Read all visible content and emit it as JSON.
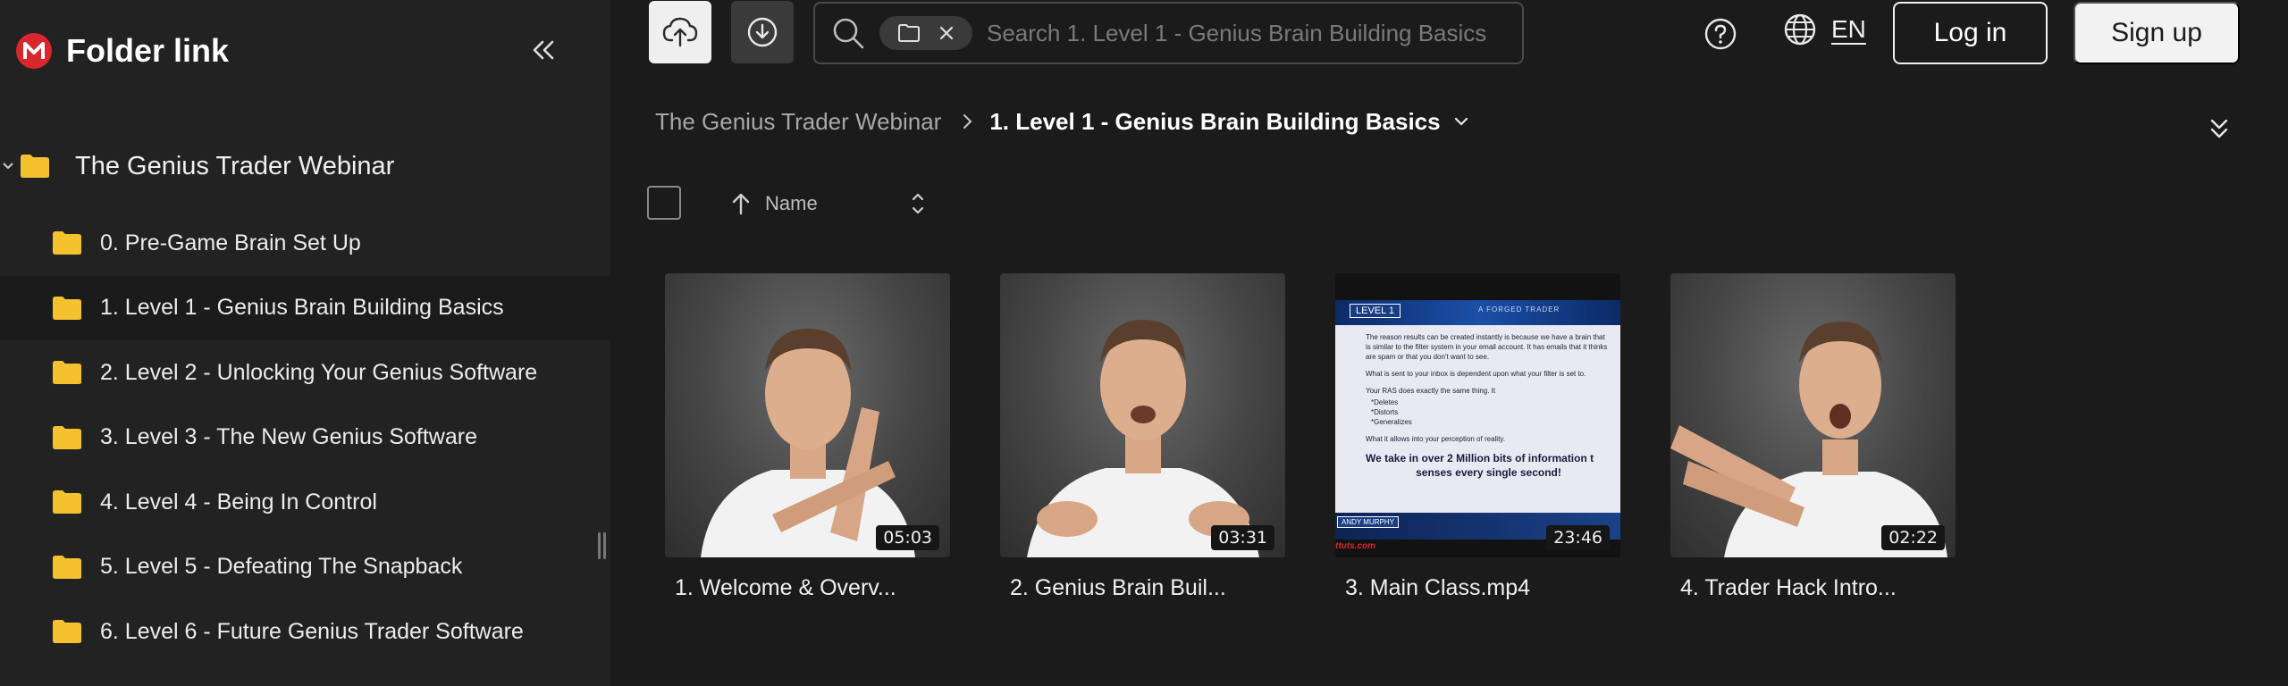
{
  "brand": {
    "name": "Folder link"
  },
  "sidebar": {
    "root": "The Genius Trader Webinar",
    "items": [
      {
        "label": "0. Pre-Game Brain Set Up"
      },
      {
        "label": "1. Level 1 - Genius Brain Building Basics"
      },
      {
        "label": "2. Level 2 - Unlocking Your Genius Software"
      },
      {
        "label": "3. Level 3 - The New Genius Software"
      },
      {
        "label": "4. Level 4 - Being In Control"
      },
      {
        "label": "5. Level 5 - Defeating The Snapback"
      },
      {
        "label": "6. Level 6 - Future Genius Trader Software"
      }
    ]
  },
  "search": {
    "placeholder": "Search 1. Level 1 - Genius Brain Building Basics"
  },
  "header": {
    "lang": "EN",
    "login": "Log in",
    "signup": "Sign up"
  },
  "breadcrumb": {
    "parent": "The Genius Trader Webinar",
    "current": "1. Level 1 - Genius Brain Building Basics"
  },
  "sort": {
    "label": "Name"
  },
  "files": [
    {
      "name": "1. Welcome & Overv...",
      "duration": "05:03"
    },
    {
      "name": "2. Genius Brain Buil...",
      "duration": "03:31"
    },
    {
      "name": "3. Main Class.mp4",
      "duration": "23:46"
    },
    {
      "name": "4. Trader Hack Intro...",
      "duration": "02:22"
    }
  ],
  "slide": {
    "level": "LEVEL 1",
    "brand": "A FORGED TRADER",
    "para1": "The reason results can be created instantly is because we have a brain that is similar to the filter system in your email account. It has emails that it thinks are spam or that you don't want to see.",
    "para2": "What is sent to your inbox is dependent upon what your filter is set to.",
    "para3": "Your RAS does exactly the same thing. It",
    "bullets": [
      "*Deletes",
      "*Distorts",
      "*Generalizes"
    ],
    "para4": "What it allows into your perception of reality.",
    "highlight1": "We take in over 2 Million bits of information t",
    "highlight2": "senses every single second!",
    "presenter": "ANDY MURPHY",
    "url": "ttuts.com"
  },
  "colors": {
    "accent": "#d9272e",
    "folder": "#f4c12f",
    "background": "#1b1b1b",
    "sidebar": "#222222"
  }
}
